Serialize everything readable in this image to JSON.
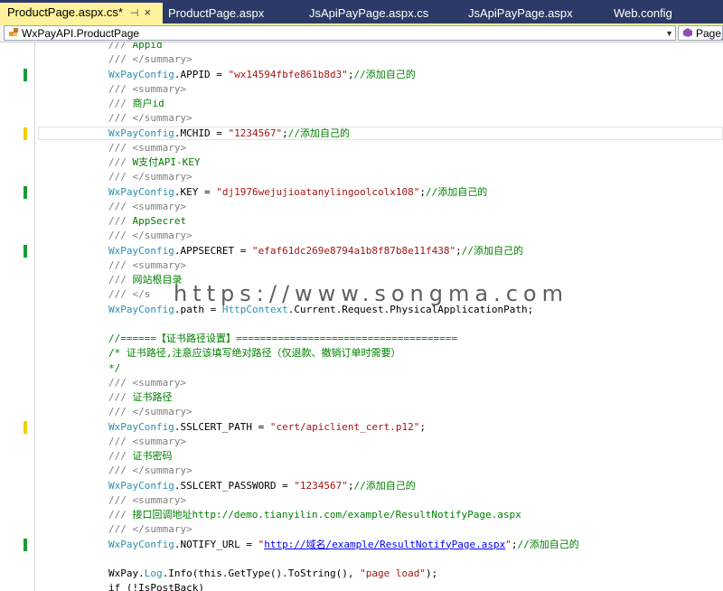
{
  "tabs": [
    {
      "label": "ProductPage.aspx.cs*",
      "active": true
    },
    {
      "label": "ProductPage.aspx",
      "active": false
    },
    {
      "label": "JsApiPayPage.aspx.cs",
      "active": false
    },
    {
      "label": "JsApiPayPage.aspx",
      "active": false
    },
    {
      "label": "Web.config",
      "active": false
    }
  ],
  "tab_pin_glyph": "⊣",
  "tab_close_glyph": "×",
  "nav": {
    "class_combo": "WxPayAPI.ProductPage",
    "member_combo": "Page_"
  },
  "colors": {
    "tab_active": "#fff29d",
    "tabbar": "#2b3a66",
    "change_saved": "#1a9a3a",
    "change_unsaved": "#f0d000",
    "comment_doc": "#7f7f7f",
    "comment_text": "#008000",
    "type": "#2b91af",
    "string": "#a31515"
  },
  "change_marks": [
    {
      "line": 2,
      "state": "saved"
    },
    {
      "line": 6,
      "state": "unsaved"
    },
    {
      "line": 10,
      "state": "saved"
    },
    {
      "line": 14,
      "state": "saved"
    },
    {
      "line": 26,
      "state": "unsaved"
    },
    {
      "line": 34,
      "state": "saved"
    }
  ],
  "code_lines": [
    {
      "line": 0,
      "segments": [
        {
          "text": "/// ",
          "cls": "c-comment"
        },
        {
          "text": "Appid",
          "cls": "c-green"
        }
      ]
    },
    {
      "line": 1,
      "segments": [
        {
          "text": "/// </summary>",
          "cls": "c-comment"
        }
      ]
    },
    {
      "line": 2,
      "segments": [
        {
          "text": "WxPayConfig",
          "cls": "c-type"
        },
        {
          "text": ".APPID = ",
          "cls": "c-plain"
        },
        {
          "text": "\"wx14594fbfe861b8d3\"",
          "cls": "c-str"
        },
        {
          "text": ";",
          "cls": "c-plain"
        },
        {
          "text": "//添加自己的",
          "cls": "c-green"
        }
      ]
    },
    {
      "line": 3,
      "segments": [
        {
          "text": "/// <summary>",
          "cls": "c-comment"
        }
      ]
    },
    {
      "line": 4,
      "segments": [
        {
          "text": "/// ",
          "cls": "c-comment"
        },
        {
          "text": "商户id",
          "cls": "c-green"
        }
      ]
    },
    {
      "line": 5,
      "segments": [
        {
          "text": "/// </summary>",
          "cls": "c-comment"
        }
      ]
    },
    {
      "line": 6,
      "segments": [
        {
          "text": "WxPayConfig",
          "cls": "c-type"
        },
        {
          "text": ".MCHID = ",
          "cls": "c-plain"
        },
        {
          "text": "\"1234567\"",
          "cls": "c-str"
        },
        {
          "text": ";",
          "cls": "c-plain"
        },
        {
          "text": "//添加自己的",
          "cls": "c-green"
        }
      ]
    },
    {
      "line": 7,
      "segments": [
        {
          "text": "/// <summary>",
          "cls": "c-comment"
        }
      ]
    },
    {
      "line": 8,
      "segments": [
        {
          "text": "/// ",
          "cls": "c-comment"
        },
        {
          "text": "W支付API-KEY",
          "cls": "c-green"
        }
      ]
    },
    {
      "line": 9,
      "segments": [
        {
          "text": "/// </summary>",
          "cls": "c-comment"
        }
      ]
    },
    {
      "line": 10,
      "segments": [
        {
          "text": "WxPayConfig",
          "cls": "c-type"
        },
        {
          "text": ".KEY = ",
          "cls": "c-plain"
        },
        {
          "text": "\"dj1976wejujioatanylingoolcolx108\"",
          "cls": "c-str"
        },
        {
          "text": ";",
          "cls": "c-plain"
        },
        {
          "text": "//添加自己的",
          "cls": "c-green"
        }
      ]
    },
    {
      "line": 11,
      "segments": [
        {
          "text": "/// <summary>",
          "cls": "c-comment"
        }
      ]
    },
    {
      "line": 12,
      "segments": [
        {
          "text": "/// ",
          "cls": "c-comment"
        },
        {
          "text": "AppSecret",
          "cls": "c-green"
        }
      ]
    },
    {
      "line": 13,
      "segments": [
        {
          "text": "/// </summary>",
          "cls": "c-comment"
        }
      ]
    },
    {
      "line": 14,
      "segments": [
        {
          "text": "WxPayConfig",
          "cls": "c-type"
        },
        {
          "text": ".APPSECRET = ",
          "cls": "c-plain"
        },
        {
          "text": "\"efaf61dc269e8794a1b8f87b8e11f438\"",
          "cls": "c-str"
        },
        {
          "text": ";",
          "cls": "c-plain"
        },
        {
          "text": "//添加自己的",
          "cls": "c-green"
        }
      ]
    },
    {
      "line": 15,
      "segments": [
        {
          "text": "/// <summary>",
          "cls": "c-comment"
        }
      ]
    },
    {
      "line": 16,
      "segments": [
        {
          "text": "/// ",
          "cls": "c-comment"
        },
        {
          "text": "网站根目录",
          "cls": "c-green"
        }
      ]
    },
    {
      "line": 17,
      "segments": [
        {
          "text": "/// </s",
          "cls": "c-comment"
        }
      ]
    },
    {
      "line": 18,
      "segments": [
        {
          "text": "WxPayConfig",
          "cls": "c-type"
        },
        {
          "text": ".path = ",
          "cls": "c-plain"
        },
        {
          "text": "HttpContext",
          "cls": "c-type"
        },
        {
          "text": ".Current.Request.PhysicalApplicationPath;",
          "cls": "c-plain"
        }
      ]
    },
    {
      "line": 20,
      "segments": [
        {
          "text": "//======【证书路径设置】=====================================",
          "cls": "c-green"
        }
      ]
    },
    {
      "line": 21,
      "segments": [
        {
          "text": "/* 证书路径,注意应该填写绝对路径（仅退款、撤销订单时需要）",
          "cls": "c-green"
        }
      ]
    },
    {
      "line": 22,
      "segments": [
        {
          "text": "*/",
          "cls": "c-green"
        }
      ]
    },
    {
      "line": 23,
      "segments": [
        {
          "text": "/// <summary>",
          "cls": "c-comment"
        }
      ]
    },
    {
      "line": 24,
      "segments": [
        {
          "text": "/// ",
          "cls": "c-comment"
        },
        {
          "text": "证书路径",
          "cls": "c-green"
        }
      ]
    },
    {
      "line": 25,
      "segments": [
        {
          "text": "/// </summary>",
          "cls": "c-comment"
        }
      ]
    },
    {
      "line": 26,
      "segments": [
        {
          "text": "WxPayConfig",
          "cls": "c-type"
        },
        {
          "text": ".SSLCERT_PATH = ",
          "cls": "c-plain"
        },
        {
          "text": "\"cert/apiclient_cert.p12\"",
          "cls": "c-str"
        },
        {
          "text": ";",
          "cls": "c-plain"
        }
      ]
    },
    {
      "line": 27,
      "segments": [
        {
          "text": "/// <summary>",
          "cls": "c-comment"
        }
      ]
    },
    {
      "line": 28,
      "segments": [
        {
          "text": "/// ",
          "cls": "c-comment"
        },
        {
          "text": "证书密码",
          "cls": "c-green"
        }
      ]
    },
    {
      "line": 29,
      "segments": [
        {
          "text": "/// </summary>",
          "cls": "c-comment"
        }
      ]
    },
    {
      "line": 30,
      "segments": [
        {
          "text": "WxPayConfig",
          "cls": "c-type"
        },
        {
          "text": ".SSLCERT_PASSWORD = ",
          "cls": "c-plain"
        },
        {
          "text": "\"1234567\"",
          "cls": "c-str"
        },
        {
          "text": ";",
          "cls": "c-plain"
        },
        {
          "text": "//添加自己的",
          "cls": "c-green"
        }
      ]
    },
    {
      "line": 31,
      "segments": [
        {
          "text": "/// <summary>",
          "cls": "c-comment"
        }
      ]
    },
    {
      "line": 32,
      "segments": [
        {
          "text": "/// ",
          "cls": "c-comment"
        },
        {
          "text": "接口回调地址http://demo.tianyilin.com/example/ResultNotifyPage.aspx",
          "cls": "c-green"
        }
      ]
    },
    {
      "line": 33,
      "segments": [
        {
          "text": "/// </summary>",
          "cls": "c-comment"
        }
      ]
    },
    {
      "line": 34,
      "segments": [
        {
          "text": "WxPayConfig",
          "cls": "c-type"
        },
        {
          "text": ".NOTIFY_URL = ",
          "cls": "c-plain"
        },
        {
          "text": "\"",
          "cls": "c-str"
        },
        {
          "text": "http://域名/example/ResultNotifyPage.aspx",
          "cls": "c-link"
        },
        {
          "text": "\"",
          "cls": "c-str"
        },
        {
          "text": ";",
          "cls": "c-plain"
        },
        {
          "text": "//添加自己的",
          "cls": "c-green"
        }
      ]
    },
    {
      "line": 36,
      "segments": [
        {
          "text": "WxPay",
          "cls": "c-plain"
        },
        {
          "text": ".",
          "cls": "c-plain"
        },
        {
          "text": "Log",
          "cls": "c-type"
        },
        {
          "text": ".Info(this.GetType().ToString(), ",
          "cls": "c-plain"
        },
        {
          "text": "\"page load\"",
          "cls": "c-str"
        },
        {
          "text": ");",
          "cls": "c-plain"
        }
      ]
    },
    {
      "line": 37,
      "segments": [
        {
          "text": "if (!IsPostBack)",
          "cls": "c-plain"
        }
      ]
    }
  ],
  "current_line": 6,
  "watermark": "https://www.songma.com"
}
